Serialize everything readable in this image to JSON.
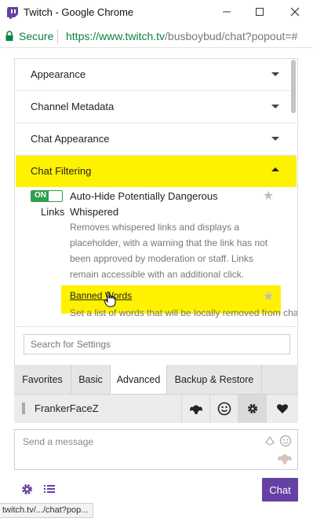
{
  "window": {
    "title": "Twitch - Google Chrome",
    "minimize_glyph": "–",
    "maximize_glyph": "□",
    "close_glyph": "✕"
  },
  "address": {
    "secure_label": "Secure",
    "url_main": "https://www.twitch.tv",
    "url_rest": "/busboybud/chat?popout=#"
  },
  "settings": {
    "sections": [
      {
        "label": "Appearance"
      },
      {
        "label": "Channel Metadata"
      },
      {
        "label": "Chat Appearance"
      },
      {
        "label": "Chat Filtering"
      }
    ],
    "auto_hide": {
      "toggle_label": "ON",
      "title_line1": "Auto-Hide Potentially Dangerous Whispered",
      "title_line2": "Links",
      "description": "Removes whispered links and displays a placeholder, with a warning that the link has not been approved by moderation or staff. Links remain accessible with an additional click."
    },
    "banned_words": {
      "title": "Banned Words",
      "description": "Set a list of words that will be locally removed from chat."
    },
    "search_placeholder": "Search for Settings"
  },
  "tabs": [
    {
      "label": "Favorites"
    },
    {
      "label": "Basic"
    },
    {
      "label": "Advanced"
    },
    {
      "label": "Backup & Restore"
    }
  ],
  "addon": {
    "name": "FrankerFaceZ"
  },
  "chat": {
    "placeholder": "Send a message",
    "send_label": "Chat"
  },
  "status_url": "twitch.tv/.../chat?pop...",
  "colors": {
    "highlight": "#fff200",
    "twitch_purple": "#6441a4",
    "toggle_green": "#2ea04f"
  }
}
